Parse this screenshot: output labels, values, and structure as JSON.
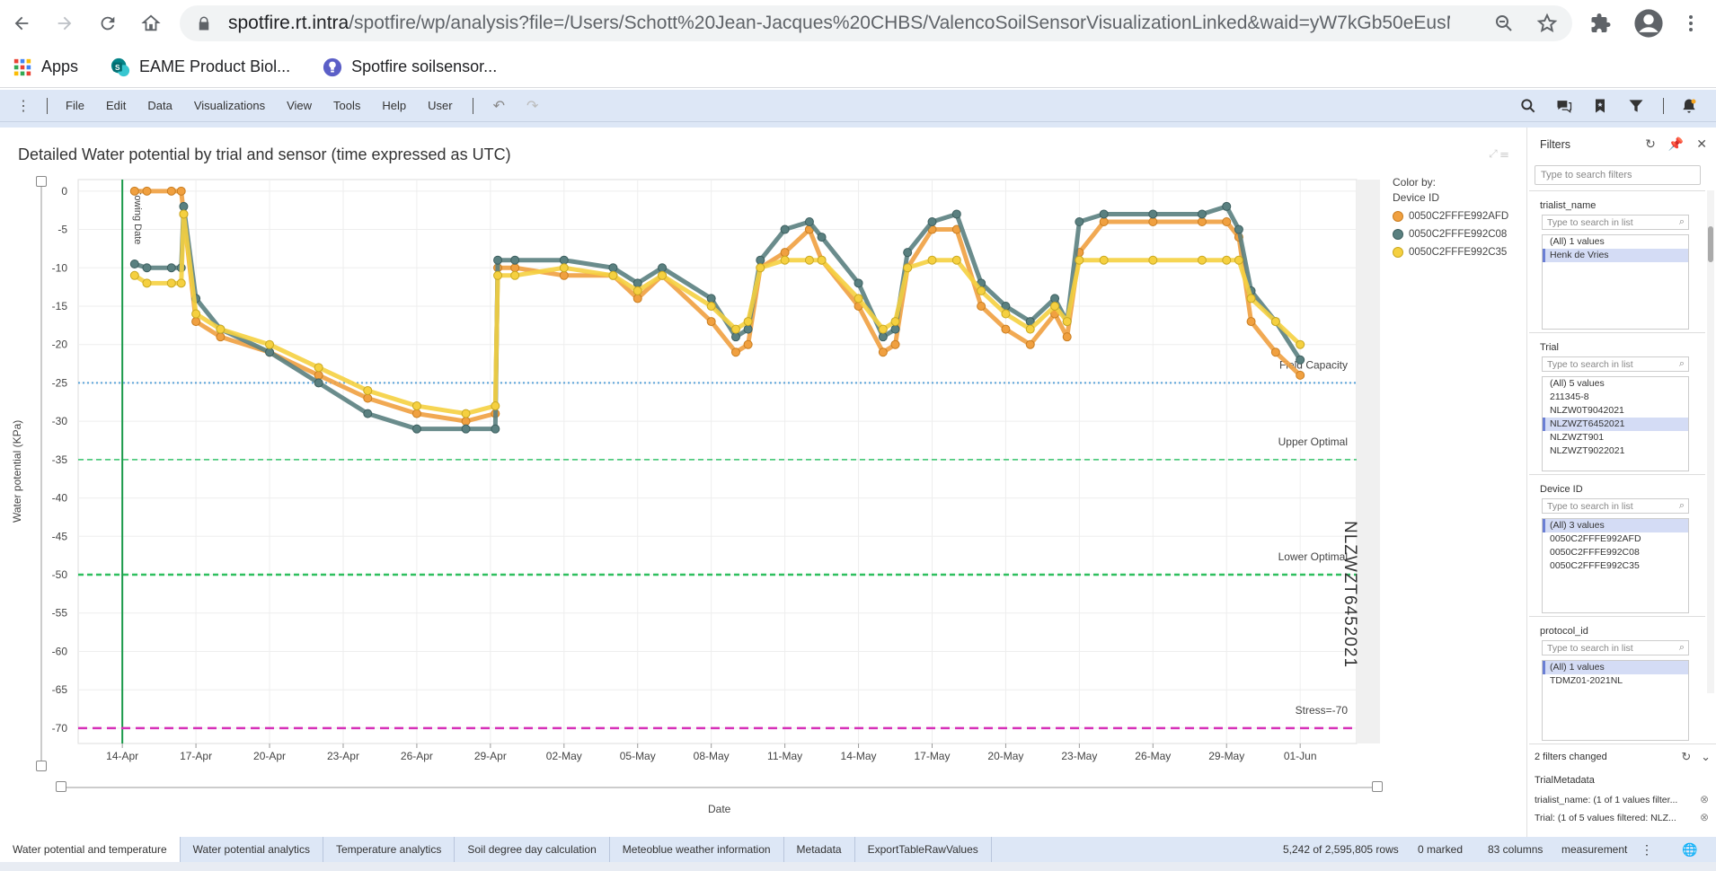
{
  "browser": {
    "url_host": "spotfire.rt.intra",
    "url_path": "/spotfire/wp/analysis?file=/Users/Schott%20Jean-Jacques%20CHBS/ValencoSoilSensorVisualizationLinked&waid=yW7kGb50eEusMvv...",
    "bookmarks": [
      {
        "label": "Apps",
        "icon": "apps-grid-icon"
      },
      {
        "label": "EAME Product Biol...",
        "icon": "sharepoint-icon"
      },
      {
        "label": "Spotfire soilsensor...",
        "icon": "spotfire-icon"
      }
    ]
  },
  "menubar": {
    "items": [
      "File",
      "Edit",
      "Data",
      "Visualizations",
      "View",
      "Tools",
      "Help",
      "User"
    ]
  },
  "viz": {
    "title": "Detailed Water potential by trial and sensor (time expressed as UTC)",
    "ylabel": "Water potential (KPa)",
    "xlabel": "Date",
    "trellis": "NLZWZT6452021",
    "legend_title": "Color by:",
    "legend_sub": "Device ID",
    "sowing_label": "Sowing Date",
    "ref_lines": [
      {
        "label": "Field Capacity",
        "value": -25,
        "color": "#5ba3d9"
      },
      {
        "label": "Upper Optimal",
        "value": -35,
        "color": "#35c46a"
      },
      {
        "label": "Lower Optimal",
        "value": -50,
        "color": "#2fbf5f"
      },
      {
        "label": "Stress=-70",
        "value": -70,
        "color": "#d62fb8"
      }
    ]
  },
  "chart_data": {
    "type": "line",
    "title": "Detailed Water potential by trial and sensor (time expressed as UTC)",
    "xlabel": "Date",
    "ylabel": "Water potential (KPa)",
    "ylim": [
      -72,
      1.5
    ],
    "yticks": [
      0,
      -5,
      -10,
      -15,
      -20,
      -25,
      -30,
      -35,
      -40,
      -45,
      -50,
      -55,
      -60,
      -65,
      -70
    ],
    "x_tick_labels": [
      "14-Apr",
      "17-Apr",
      "20-Apr",
      "23-Apr",
      "26-Apr",
      "29-Apr",
      "02-May",
      "05-May",
      "08-May",
      "11-May",
      "14-May",
      "17-May",
      "20-May",
      "23-May",
      "26-May",
      "29-May",
      "01-Jun"
    ],
    "x_tick_days": [
      0,
      3,
      6,
      9,
      12,
      15,
      18,
      21,
      24,
      27,
      30,
      33,
      36,
      39,
      42,
      45,
      48
    ],
    "xlim_days": [
      -1.8,
      50.3
    ],
    "grid": true,
    "legend": "top-right",
    "series": [
      {
        "name": "0050C2FFFE992AFD",
        "color": "#f0a040",
        "x": [
          0.5,
          1,
          2,
          2.4,
          2.5,
          3,
          4,
          6,
          8,
          10,
          12,
          14,
          15.2,
          15.3,
          16,
          18,
          20,
          21,
          22,
          24,
          25,
          25.5,
          26,
          27,
          28,
          28.5,
          30,
          31,
          31.5,
          32,
          33,
          34,
          35,
          36,
          37,
          38,
          38.5,
          39,
          40,
          42,
          44,
          45,
          45.5,
          46,
          47,
          48
        ],
        "y": [
          0,
          0,
          0,
          0,
          -3,
          -17,
          -19,
          -21,
          -24,
          -27,
          -29,
          -30,
          -29,
          -10,
          -10,
          -11,
          -11,
          -14,
          -11,
          -17,
          -21,
          -20,
          -10,
          -8,
          -5,
          -9,
          -15,
          -21,
          -20,
          -10,
          -5,
          -5,
          -15,
          -18,
          -20,
          -16,
          -19,
          -8,
          -4,
          -4,
          -4,
          -4,
          -6,
          -17,
          -21,
          -24
        ]
      },
      {
        "name": "0050C2FFFE992C08",
        "color": "#5a8080",
        "x": [
          0.5,
          1,
          2,
          2.4,
          2.5,
          3,
          4,
          6,
          8,
          10,
          12,
          14,
          15.2,
          15.3,
          16,
          18,
          20,
          21,
          22,
          24,
          25,
          25.5,
          26,
          27,
          28,
          28.5,
          30,
          31,
          31.5,
          32,
          33,
          34,
          35,
          36,
          37,
          38,
          38.5,
          39,
          40,
          42,
          44,
          45,
          45.5,
          46,
          47,
          48
        ],
        "y": [
          -9.5,
          -10,
          -10,
          -10,
          -2,
          -14,
          -18,
          -21,
          -25,
          -29,
          -31,
          -31,
          -31,
          -9,
          -9,
          -9,
          -10,
          -12,
          -10,
          -14,
          -19,
          -18,
          -9,
          -5,
          -4,
          -6,
          -12,
          -19,
          -18,
          -8,
          -4,
          -3,
          -12,
          -15,
          -17,
          -14,
          -17,
          -4,
          -3,
          -3,
          -3,
          -2,
          -5,
          -13,
          -17,
          -22
        ]
      },
      {
        "name": "0050C2FFFE992C35",
        "color": "#f5d040",
        "x": [
          0.5,
          1,
          2,
          2.4,
          2.5,
          3,
          4,
          6,
          8,
          10,
          12,
          14,
          15.2,
          15.3,
          16,
          18,
          20,
          21,
          22,
          24,
          25,
          25.5,
          26,
          27,
          28,
          28.5,
          30,
          31,
          31.5,
          32,
          33,
          34,
          35,
          36,
          37,
          38,
          38.5,
          39,
          40,
          42,
          44,
          45,
          45.5,
          46,
          47,
          48
        ],
        "y": [
          -11,
          -12,
          -12,
          -12,
          -3,
          -16,
          -18,
          -20,
          -23,
          -26,
          -28,
          -29,
          -28,
          -11,
          -11,
          -10,
          -11,
          -13,
          -11,
          -15,
          -18,
          -17,
          -10,
          -9,
          -9,
          -9,
          -14,
          -18,
          -17,
          -10,
          -9,
          -9,
          -13,
          -16,
          -18,
          -15,
          -17,
          -9,
          -9,
          -9,
          -9,
          -9,
          -9,
          -14,
          -17,
          -20
        ]
      }
    ]
  },
  "filters": {
    "title": "Filters",
    "search_placeholder": "Type to search filters",
    "groups": [
      {
        "name": "trialist_name",
        "placeholder": "Type to search in list",
        "items": [
          {
            "label": "(All) 1 values",
            "selected": false
          },
          {
            "label": "Henk de Vries",
            "selected": true
          }
        ]
      },
      {
        "name": "Trial",
        "placeholder": "Type to search in list",
        "items": [
          {
            "label": "(All) 5 values",
            "selected": false
          },
          {
            "label": "211345-8",
            "selected": false
          },
          {
            "label": "NLZW0T9042021",
            "selected": false
          },
          {
            "label": "NLZWZT6452021",
            "selected": true
          },
          {
            "label": "NLZWZT901",
            "selected": false
          },
          {
            "label": "NLZWZT9022021",
            "selected": false
          }
        ]
      },
      {
        "name": "Device ID",
        "placeholder": "Type to search in list",
        "items": [
          {
            "label": "(All) 3 values",
            "selected": true
          },
          {
            "label": "0050C2FFFE992AFD",
            "selected": false
          },
          {
            "label": "0050C2FFFE992C08",
            "selected": false
          },
          {
            "label": "0050C2FFFE992C35",
            "selected": false
          }
        ]
      },
      {
        "name": "protocol_id",
        "placeholder": "Type to search in list",
        "items": [
          {
            "label": "(All) 1 values",
            "selected": true
          },
          {
            "label": "TDMZ01-2021NL",
            "selected": false
          }
        ]
      }
    ],
    "changed": "2 filters changed",
    "metadata_title": "TrialMetadata",
    "metadata_rows": [
      "trialist_name: (1 of 1 values filter...",
      "Trial: (1 of 5 values filtered: NLZ..."
    ]
  },
  "tabs": {
    "items": [
      "Water potential and temperature",
      "Water potential analytics",
      "Temperature analytics",
      "Soil degree day calculation",
      "Meteoblue weather information",
      "Metadata",
      "ExportTableRawValues"
    ],
    "active_index": 0
  },
  "status": {
    "rows": "5,242 of 2,595,805 rows",
    "marked": "0 marked",
    "columns": "83 columns",
    "table": "measurement"
  }
}
